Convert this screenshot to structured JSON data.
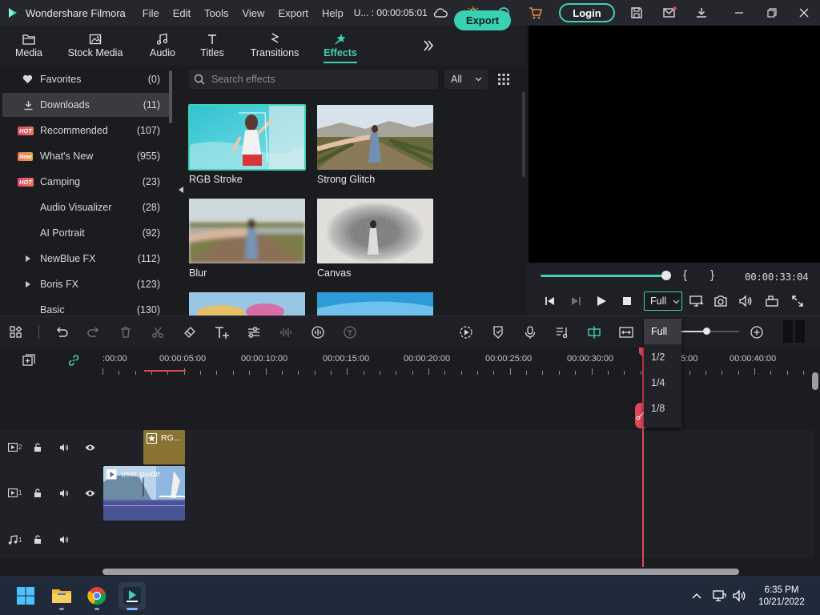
{
  "app": {
    "title": "Wondershare Filmora",
    "project_label": "U... : 00:00:05:01",
    "menus": [
      "File",
      "Edit",
      "Tools",
      "View",
      "Export",
      "Help"
    ],
    "login_label": "Login",
    "accent_color": "#3fd1b6"
  },
  "media_tabs": [
    {
      "label": "Media",
      "icon": "folder-icon"
    },
    {
      "label": "Stock Media",
      "icon": "stock-media-icon"
    },
    {
      "label": "Audio",
      "icon": "music-note-icon"
    },
    {
      "label": "Titles",
      "icon": "text-icon"
    },
    {
      "label": "Transitions",
      "icon": "transitions-icon"
    },
    {
      "label": "Effects",
      "icon": "effects-icon",
      "active": true
    }
  ],
  "export_label": "Export",
  "categories": [
    {
      "label": "Favorites",
      "count": "(0)",
      "icon": "heart-icon"
    },
    {
      "label": "Downloads",
      "count": "(11)",
      "icon": "download-icon",
      "selected": true
    },
    {
      "label": "Recommended",
      "count": "(107)",
      "badge": "HOT"
    },
    {
      "label": "What's New",
      "count": "(955)",
      "badge": "New"
    },
    {
      "label": "Camping",
      "count": "(23)",
      "badge": "HOT"
    },
    {
      "label": "Audio Visualizer",
      "count": "(28)"
    },
    {
      "label": "AI Portrait",
      "count": "(92)"
    },
    {
      "label": "NewBlue FX",
      "count": "(112)",
      "expandable": true
    },
    {
      "label": "Boris FX",
      "count": "(123)",
      "expandable": true
    },
    {
      "label": "Basic",
      "count": "(130)"
    }
  ],
  "search": {
    "placeholder": "Search effects",
    "filter": "All"
  },
  "effects": [
    {
      "label": "RGB Stroke",
      "selected": true
    },
    {
      "label": "Strong Glitch"
    },
    {
      "label": "Blur"
    },
    {
      "label": "Canvas"
    }
  ],
  "preview": {
    "time": "00:00:33:04",
    "progress": 1.0,
    "quality_selected": "Full",
    "quality_options": [
      "Full",
      "1/2",
      "1/4",
      "1/8"
    ]
  },
  "ruler": {
    "labels": [
      ":00:00",
      "00:00:05:00",
      "00:00:10:00",
      "00:00:15:00",
      "00:00:20:00",
      "00:00:25:00",
      "00:00:30:00",
      "5:00",
      "00:00:40:00"
    ]
  },
  "tracks": [
    {
      "kind": "video",
      "num": "2"
    },
    {
      "kind": "video",
      "num": "1"
    },
    {
      "kind": "audio",
      "num": "1"
    }
  ],
  "clips": {
    "effect_clip": "RG...",
    "video_clip": "user guide"
  },
  "taskbar": {
    "time": "6:35 PM",
    "date": "10/21/2022"
  }
}
